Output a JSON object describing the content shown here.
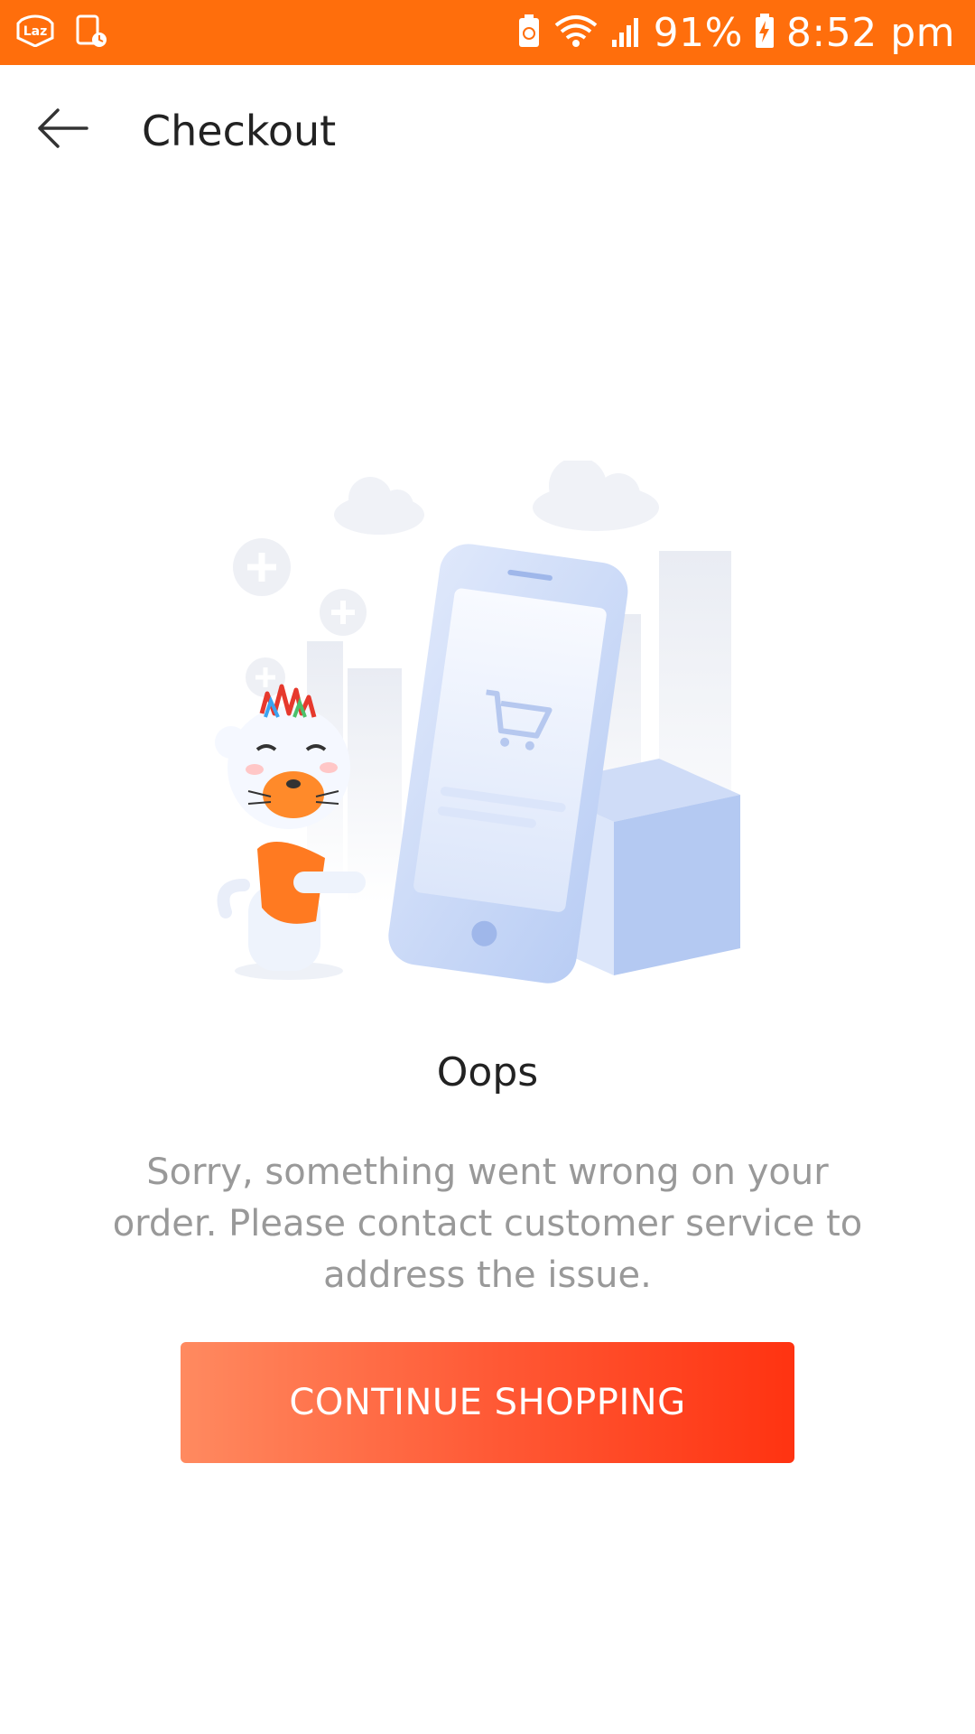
{
  "status_bar": {
    "battery_percent": "91%",
    "time": "8:52 pm",
    "icons": [
      "lazada-notification-icon",
      "screen-recorder-icon",
      "battery-saver-icon",
      "wifi-icon",
      "signal-icon",
      "battery-charging-icon"
    ]
  },
  "header": {
    "back_icon": "arrow-left-icon",
    "title": "Checkout"
  },
  "illustration": {
    "description_icon": "empty-cart-mascot-illustration"
  },
  "error": {
    "title": "Oops",
    "message": "Sorry, something went wrong on your order. Please contact customer service to address the issue."
  },
  "actions": {
    "continue_label": "CONTINUE SHOPPING"
  },
  "colors": {
    "status_bar": "#ff6e0c",
    "button_start": "#ff8a60",
    "button_end": "#ff3311",
    "message_text": "#999999"
  }
}
